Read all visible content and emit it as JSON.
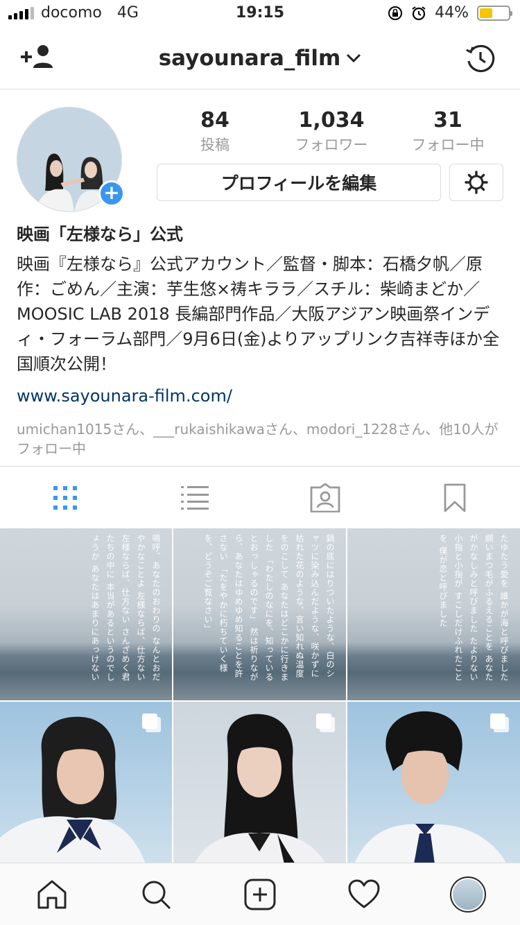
{
  "status_bar": {
    "carrier": "docomo",
    "network": "4G",
    "time": "19:15",
    "battery": "44%",
    "battery_level": 0.44
  },
  "nav": {
    "username": "sayounara_film",
    "add_user_icon": "add-user-icon",
    "archive_icon": "history-icon"
  },
  "profile": {
    "stats": [
      {
        "value": "84",
        "label": "投稿"
      },
      {
        "value": "1,034",
        "label": "フォロワー"
      },
      {
        "value": "31",
        "label": "フォロー中"
      }
    ],
    "edit_button": "プロフィールを編集",
    "name": "映画「左様なら」公式",
    "bio": "映画『左様なら』公式アカウント／監督・脚本：石橋夕帆／原作：ごめん／主演：芋生悠×祷キララ／スチル：柴崎まどか／MOOSIC LAB 2018 長編部門作品／大阪アジアン映画祭インディ・フォーラム部門／9月6日(金)よりアップリンク吉祥寺ほか全国順次公開！",
    "link": "www.sayounara-film.com/",
    "followed_by": "umichan1015さん、___rukaishikawaさん、modori_1228さん、他10人がフォロー中"
  },
  "grid_posts": [
    {
      "type": "text-sea",
      "text": "鳴呼、あなたのおわりの なんとおだやかなことよ 左様ならば、仕方ない 左様ならば、仕方ない さんざめく君たちの中に 本当があるというのでしょうか あなたはあまりにあっけない"
    },
    {
      "type": "text-sea",
      "text": "鍋の底にはりついたような、白のシャツに染み込んだような、咲かずに枯れた花のような、言い知れぬ温度をのこして あなたはどこかに行きました 「わたしのなにを、知っているとおっしゃるのです」 然は祈りながら、あなたはゆめゆめ知ることを許さない 「たをやかに朽ちていく様を、どうぞご覧なさい」"
    },
    {
      "type": "text-sea",
      "text": "たゆたう愛を 誰かが海と呼びました 綱いまつ毛がふるえることを あなたがかなしみと呼びました たよりない 小指と小指が すこしだけふれたことを 僕が恋と呼びました"
    },
    {
      "type": "portrait",
      "multi": true
    },
    {
      "type": "portrait",
      "multi": true
    },
    {
      "type": "portrait",
      "multi": true
    }
  ]
}
